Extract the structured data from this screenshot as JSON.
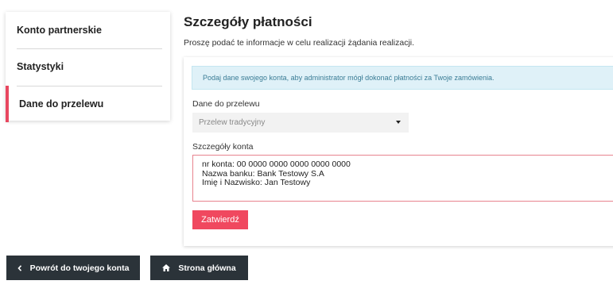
{
  "sidebar": {
    "items": [
      {
        "label": "Konto partnerskie"
      },
      {
        "label": "Statystyki"
      },
      {
        "label": "Dane do przelewu"
      }
    ]
  },
  "main": {
    "title": "Szczegóły płatności",
    "subtitle": "Proszę podać te informacje w celu realizacji żądania realizacji.",
    "alert": "Podaj dane swojego konta, aby administrator mógł dokonać płatności za Twoje zamówienia.",
    "transfer_label": "Dane do przelewu",
    "transfer_select_value": "Przelew tradycyjny",
    "account_label": "Szczegóły konta",
    "account_details": "nr konta: 00 0000 0000 0000 0000 0000\nNazwa banku: Bank Testowy S.A\nImię i Nazwisko: Jan Testowy",
    "submit_label": "Zatwierdź"
  },
  "footer": {
    "back_label": "Powrót do twojego konta",
    "home_label": "Strona główna"
  },
  "colors": {
    "accent": "#f0485f",
    "dark_button": "#2b3339",
    "alert_bg": "#dff1f8",
    "alert_text": "#3a7c95"
  },
  "icons": {
    "back": "chevron-left-icon",
    "home": "home-icon",
    "select": "caret-down-icon"
  }
}
